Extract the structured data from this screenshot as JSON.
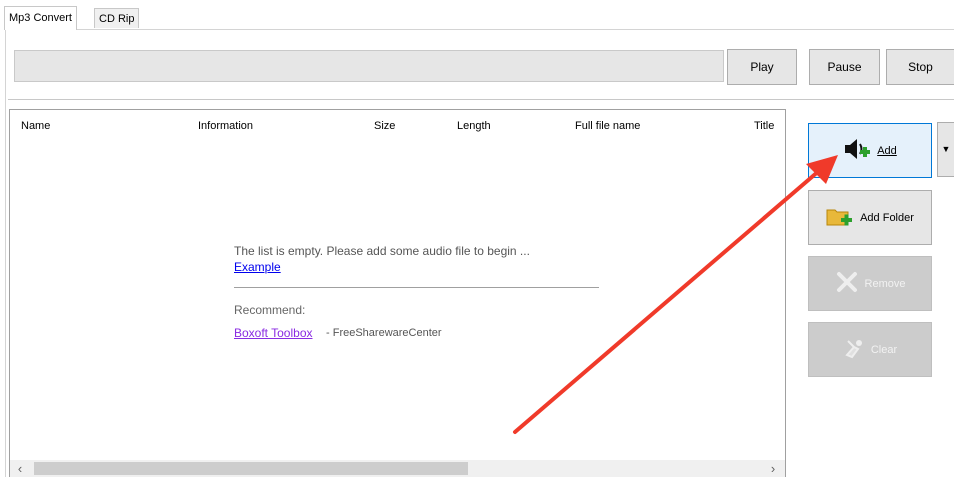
{
  "tabs": [
    {
      "label": "Mp3 Convert",
      "active": true
    },
    {
      "label": "CD Rip",
      "active": false
    }
  ],
  "player": {
    "progress": 0,
    "play_label": "Play",
    "pause_label": "Pause",
    "stop_label": "Stop"
  },
  "list": {
    "columns": [
      "Name",
      "Information",
      "Size",
      "Length",
      "Full file name",
      "Title"
    ],
    "empty_message": "The list is empty. Please add some audio file to begin ...",
    "example_link": "Example",
    "recommend_label": "Recommend:",
    "recommend_link": "Boxoft Toolbox",
    "recommend_suffix": "- FreeSharewareCenter"
  },
  "actions": {
    "add_label": "Add",
    "add_folder_label": "Add Folder",
    "remove_label": "Remove",
    "clear_label": "Clear"
  },
  "colors": {
    "accent": "#0078d7",
    "link": "#0000ee",
    "visited_link": "#8a2be2",
    "annotation_arrow": "#f03a2a"
  },
  "icons": [
    "speaker-plus-icon",
    "folder-plus-icon",
    "remove-x-icon",
    "broom-clear-icon",
    "dropdown-caret-icon",
    "chevron-left-icon",
    "chevron-right-icon"
  ]
}
